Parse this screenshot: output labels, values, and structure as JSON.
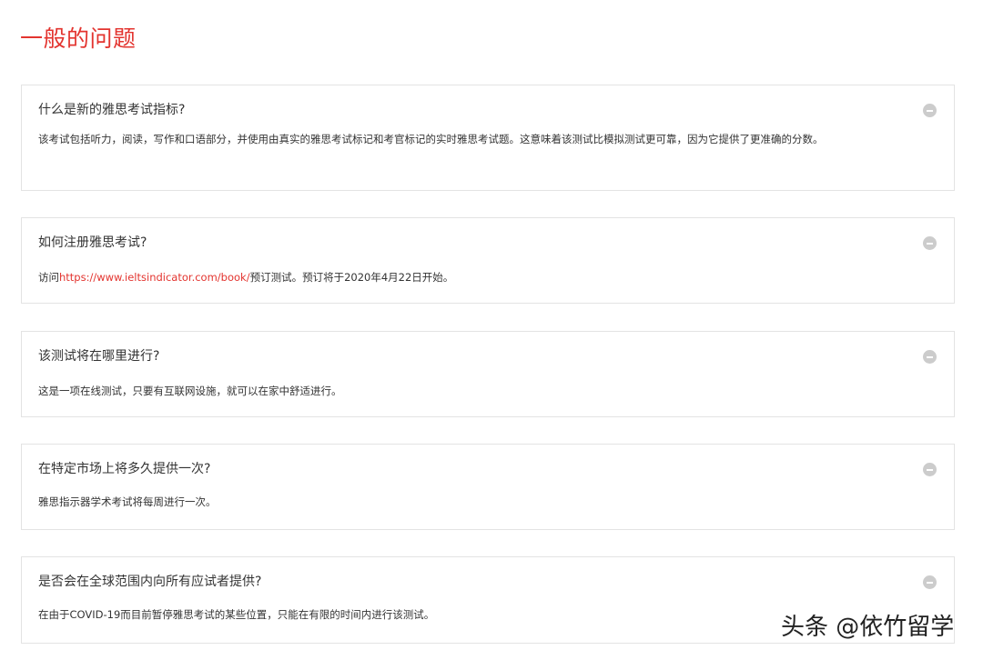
{
  "page": {
    "title": "一般的问题"
  },
  "colors": {
    "title": "#e3342f",
    "link": "#e3342f",
    "border": "#e3e3e3",
    "icon": "#cccccc",
    "text": "#333333"
  },
  "faq": [
    {
      "question": "什么是新的雅思考试指标?",
      "answer": "该考试包括听力，阅读，写作和口语部分，并使用由真实的雅思考试标记和考官标记的实时雅思考试题。这意味着该测试比模拟测试更可靠，因为它提供了更准确的分数。",
      "icon": "minus-circle-icon"
    },
    {
      "question": "如何注册雅思考试?",
      "answer_prefix": "访问",
      "answer_link": "https://www.ieltsindicator.com/book/",
      "answer_suffix": "预订测试。预订将于2020年4月22日开始。",
      "icon": "minus-circle-icon"
    },
    {
      "question": "该测试将在哪里进行?",
      "answer": "这是一项在线测试，只要有互联网设施，就可以在家中舒适进行。",
      "icon": "minus-circle-icon"
    },
    {
      "question": "在特定市场上将多久提供一次?",
      "answer": "雅思指示器学术考试将每周进行一次。",
      "icon": "minus-circle-icon"
    },
    {
      "question": "是否会在全球范围内向所有应试者提供?",
      "answer": "在由于COVID-19而目前暂停雅思考试的某些位置，只能在有限的时间内进行该测试。",
      "icon": "minus-circle-icon"
    }
  ],
  "watermark": {
    "text": "头条 @依竹留学"
  }
}
